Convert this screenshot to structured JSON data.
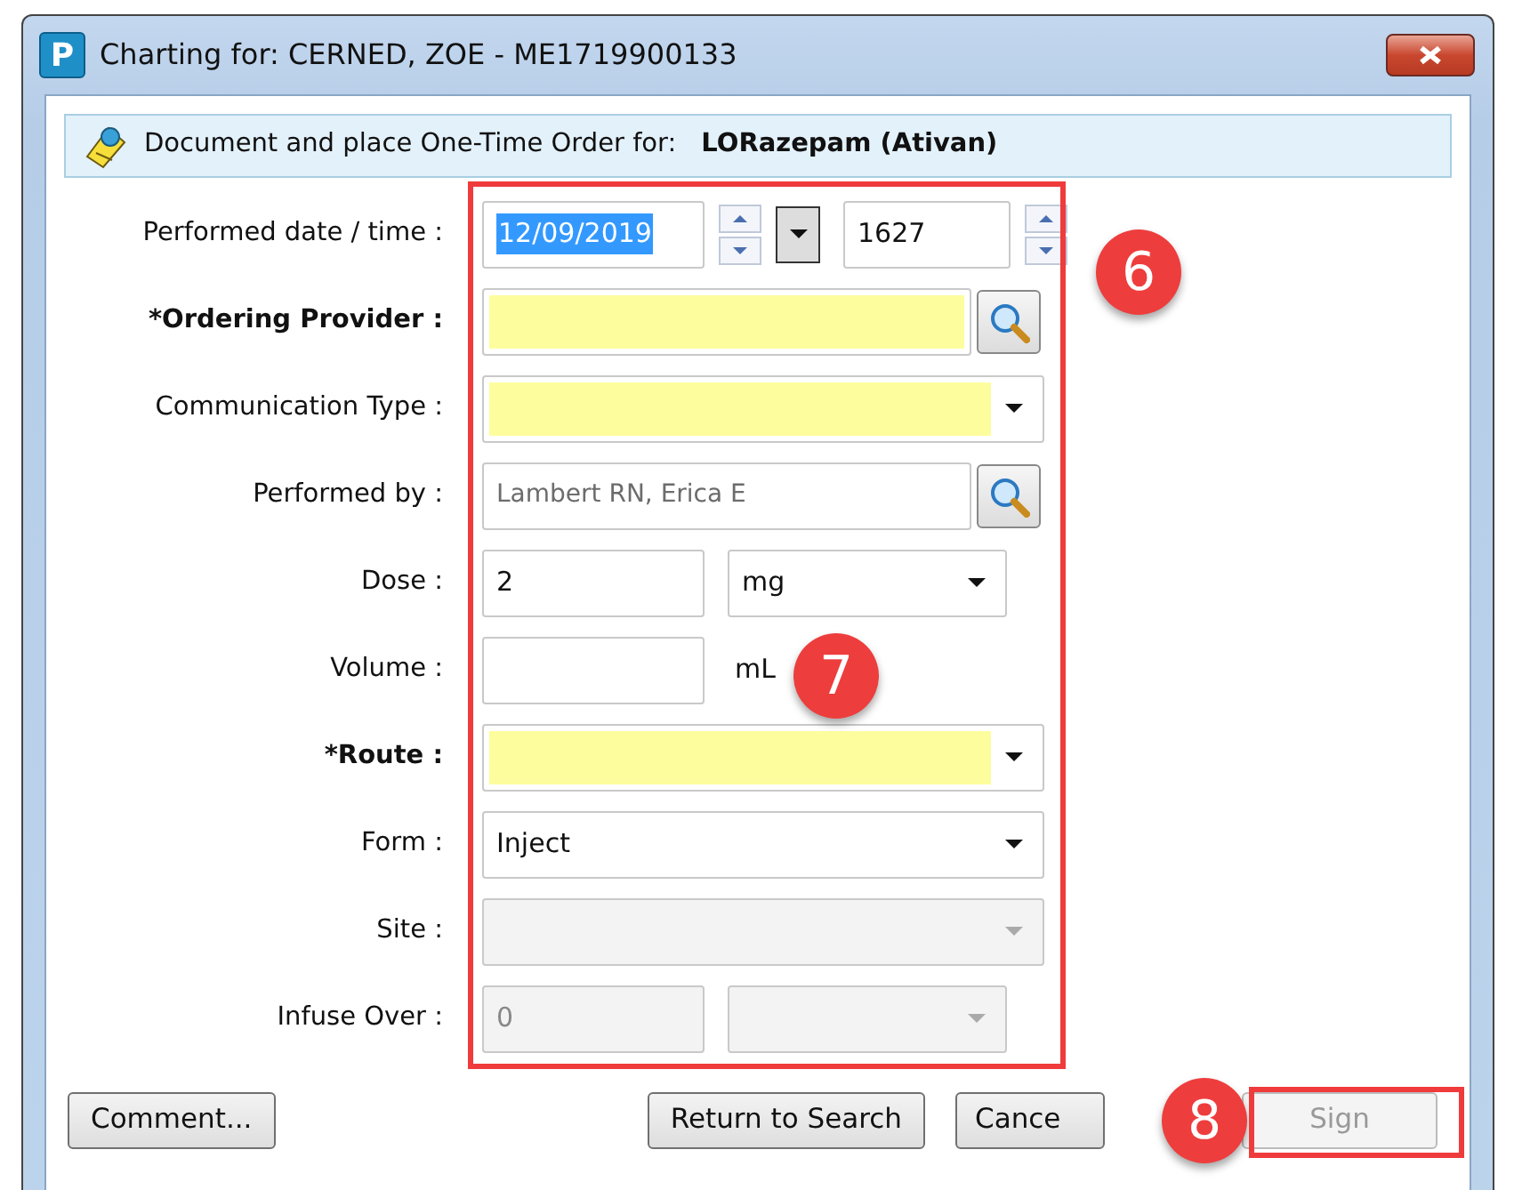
{
  "window": {
    "title": "Charting for: CERNED, ZOE - ME1719900133",
    "app_icon": "P"
  },
  "header": {
    "text": "Document and place One-Time Order for:",
    "order": "LORazepam (Ativan)"
  },
  "rows": [
    {
      "label": "Performed date / time :",
      "required": false,
      "fields": [
        {
          "kind": "date",
          "value": "12/09/2019",
          "selected": true
        },
        {
          "kind": "time",
          "value": "1627"
        }
      ]
    },
    {
      "label": "*Ordering Provider :",
      "required": true,
      "fields": [
        {
          "kind": "lookup",
          "highlighted": true,
          "disabled": false
        }
      ]
    },
    {
      "label": "Communication Type :",
      "required": false,
      "fields": [
        {
          "kind": "combo",
          "highlighted": true,
          "disabled": false
        }
      ]
    },
    {
      "label": "Performed by :",
      "required": false,
      "fields": [
        {
          "kind": "lookup",
          "value": "Lambert RN, Erica E",
          "highlighted": false,
          "disabled": false,
          "readonly": true
        }
      ]
    },
    {
      "label": "Dose :",
      "required": false,
      "fields": [
        {
          "kind": "text",
          "value": "2",
          "disabled": false
        },
        {
          "kind": "combo",
          "value": "mg",
          "highlighted": false,
          "disabled": false
        }
      ]
    },
    {
      "label": "Volume :",
      "required": false,
      "fields": [
        {
          "kind": "text",
          "disabled": false
        },
        {
          "kind": "unit",
          "value": "mL"
        }
      ]
    },
    {
      "label": "*Route :",
      "required": true,
      "fields": [
        {
          "kind": "combo",
          "highlighted": true,
          "disabled": false
        }
      ]
    },
    {
      "label": "Form :",
      "required": false,
      "fields": [
        {
          "kind": "combo",
          "value": "Inject",
          "highlighted": false,
          "disabled": false
        }
      ]
    },
    {
      "label": "Site :",
      "required": false,
      "fields": [
        {
          "kind": "combo",
          "highlighted": false,
          "disabled": true
        }
      ]
    },
    {
      "label": "Infuse Over :",
      "required": false,
      "fields": [
        {
          "kind": "text",
          "value": "0",
          "disabled": true
        },
        {
          "kind": "combo",
          "highlighted": false,
          "disabled": true
        }
      ]
    }
  ],
  "buttons": [
    {
      "label": "Comment...",
      "disabled": false
    },
    {
      "label": "Return to Search",
      "disabled": false
    },
    {
      "label": "Cance",
      "disabled": false
    },
    {
      "label": "Sign",
      "disabled": true
    }
  ],
  "annotations": [
    {
      "kind": "frame"
    },
    {
      "kind": "step",
      "label": "6"
    },
    {
      "kind": "step",
      "label": "7"
    },
    {
      "kind": "step",
      "label": "8"
    },
    {
      "kind": "frame"
    }
  ]
}
